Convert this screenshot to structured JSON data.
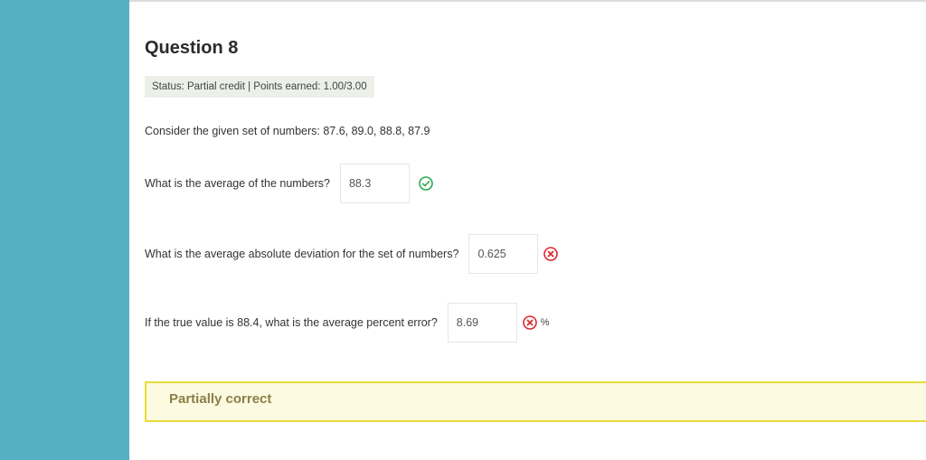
{
  "question": {
    "title": "Question 8",
    "status": "Status: Partial credit | Points earned: 1.00/3.00",
    "prompt": "Consider the given set of numbers: 87.6, 89.0, 88.8, 87.9"
  },
  "parts": [
    {
      "label": "What is the average of the numbers?",
      "answer": "88.3",
      "result_icon": "check-circle-icon",
      "correct": true,
      "unit": ""
    },
    {
      "label": "What is the average absolute deviation for the set of numbers?",
      "answer": "0.625",
      "result_icon": "x-circle-icon",
      "correct": false,
      "unit": ""
    },
    {
      "label": "If the true value is 88.4, what is the average percent error?",
      "answer": "8.69",
      "result_icon": "x-circle-icon",
      "correct": false,
      "unit": "%"
    }
  ],
  "feedback": {
    "text": "Partially correct"
  },
  "colors": {
    "sidebar": "#55b0c1",
    "correct": "#2fa84f",
    "incorrect": "#d9282f",
    "feedback_border": "#e8da3a",
    "feedback_bg": "#fcfbe1"
  }
}
